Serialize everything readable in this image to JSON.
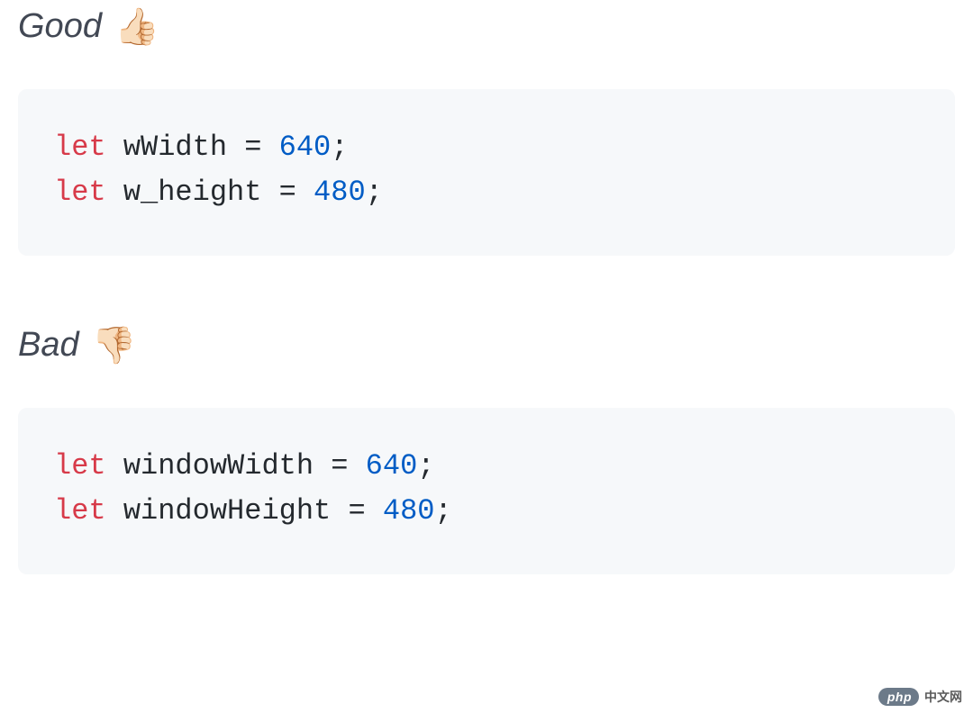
{
  "good": {
    "heading": "Good",
    "emoji": "👍🏻",
    "code": {
      "line1": {
        "keyword": "let",
        "ident": " wWidth ",
        "op": "=",
        "sp": " ",
        "num": "640",
        "end": ";"
      },
      "line2": {
        "keyword": "let",
        "ident": " w_height ",
        "op": "=",
        "sp": " ",
        "num": "480",
        "end": ";"
      }
    }
  },
  "bad": {
    "heading": "Bad",
    "emoji": "👎🏻",
    "code": {
      "line1": {
        "keyword": "let",
        "ident": " windowWidth ",
        "op": "=",
        "sp": " ",
        "num": "640",
        "end": ";"
      },
      "line2": {
        "keyword": "let",
        "ident": " windowHeight ",
        "op": "=",
        "sp": " ",
        "num": "480",
        "end": ";"
      }
    }
  },
  "watermark": {
    "badge": "php",
    "text": "中文网"
  }
}
